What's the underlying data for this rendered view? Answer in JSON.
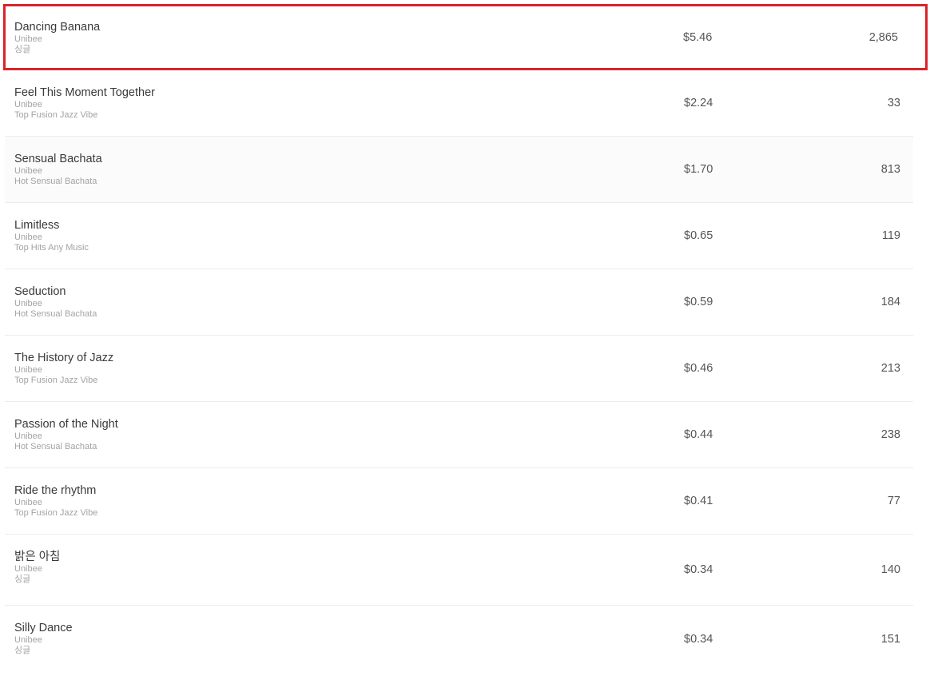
{
  "tracks": [
    {
      "title": "Dancing Banana",
      "artist": "Unibee",
      "album": "싱글",
      "earnings": "$5.46",
      "streams": "2,865",
      "selected": true
    },
    {
      "title": "Feel This Moment Together",
      "artist": "Unibee",
      "album": "Top Fusion Jazz Vibe",
      "earnings": "$2.24",
      "streams": "33"
    },
    {
      "title": "Sensual Bachata",
      "artist": "Unibee",
      "album": "Hot Sensual Bachata",
      "earnings": "$1.70",
      "streams": "813"
    },
    {
      "title": "Limitless",
      "artist": "Unibee",
      "album": "Top Hits Any Music",
      "earnings": "$0.65",
      "streams": "119"
    },
    {
      "title": "Seduction",
      "artist": "Unibee",
      "album": "Hot Sensual Bachata",
      "earnings": "$0.59",
      "streams": "184"
    },
    {
      "title": "The History of Jazz",
      "artist": "Unibee",
      "album": "Top Fusion Jazz Vibe",
      "earnings": "$0.46",
      "streams": "213"
    },
    {
      "title": "Passion of the Night",
      "artist": "Unibee",
      "album": "Hot Sensual Bachata",
      "earnings": "$0.44",
      "streams": "238"
    },
    {
      "title": "Ride the rhythm",
      "artist": "Unibee",
      "album": "Top Fusion Jazz Vibe",
      "earnings": "$0.41",
      "streams": "77"
    },
    {
      "title": "밝은 아침",
      "artist": "Unibee",
      "album": "싱글",
      "earnings": "$0.34",
      "streams": "140"
    },
    {
      "title": "Silly Dance",
      "artist": "Unibee",
      "album": "싱글",
      "earnings": "$0.34",
      "streams": "151"
    }
  ],
  "colors": {
    "selected_border": "#d9232a",
    "row_divider": "#ececec",
    "secondary_text": "#a3a3a3"
  }
}
